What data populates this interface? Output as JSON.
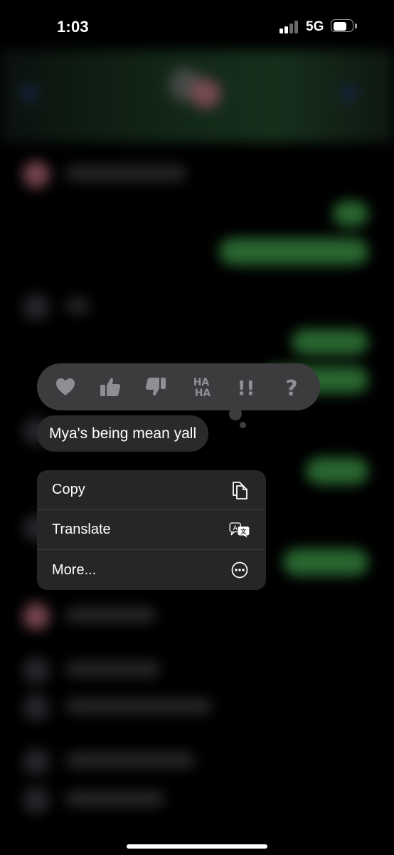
{
  "status_bar": {
    "time": "1:03",
    "network": "5G",
    "signal_bars_filled": 2,
    "signal_bars_total": 4,
    "battery_level": 0.7
  },
  "tapbacks": [
    {
      "name": "heart",
      "icon": "heart-icon"
    },
    {
      "name": "thumbs-up",
      "icon": "thumbs-up-icon"
    },
    {
      "name": "thumbs-down",
      "icon": "thumbs-down-icon"
    },
    {
      "name": "haha",
      "icon": "haha-icon",
      "text_top": "HA",
      "text_bottom": "HA"
    },
    {
      "name": "emphasize",
      "icon": "double-exclamation-icon",
      "text": "!!"
    },
    {
      "name": "question",
      "icon": "question-mark-icon",
      "text": "?"
    }
  ],
  "message": {
    "text": "Mya's being mean yall"
  },
  "context_menu": {
    "items": [
      {
        "label": "Copy",
        "icon": "copy-icon"
      },
      {
        "label": "Translate",
        "icon": "translate-icon"
      },
      {
        "label": "More...",
        "icon": "more-icon"
      }
    ]
  },
  "colors": {
    "background": "#000000",
    "tapback_bar": "#3c3c3f",
    "tapback_icon": "#8e8e93",
    "bubble": "#2a2a2d",
    "menu": "#262628",
    "imessage_green": "#3f9e4b"
  }
}
